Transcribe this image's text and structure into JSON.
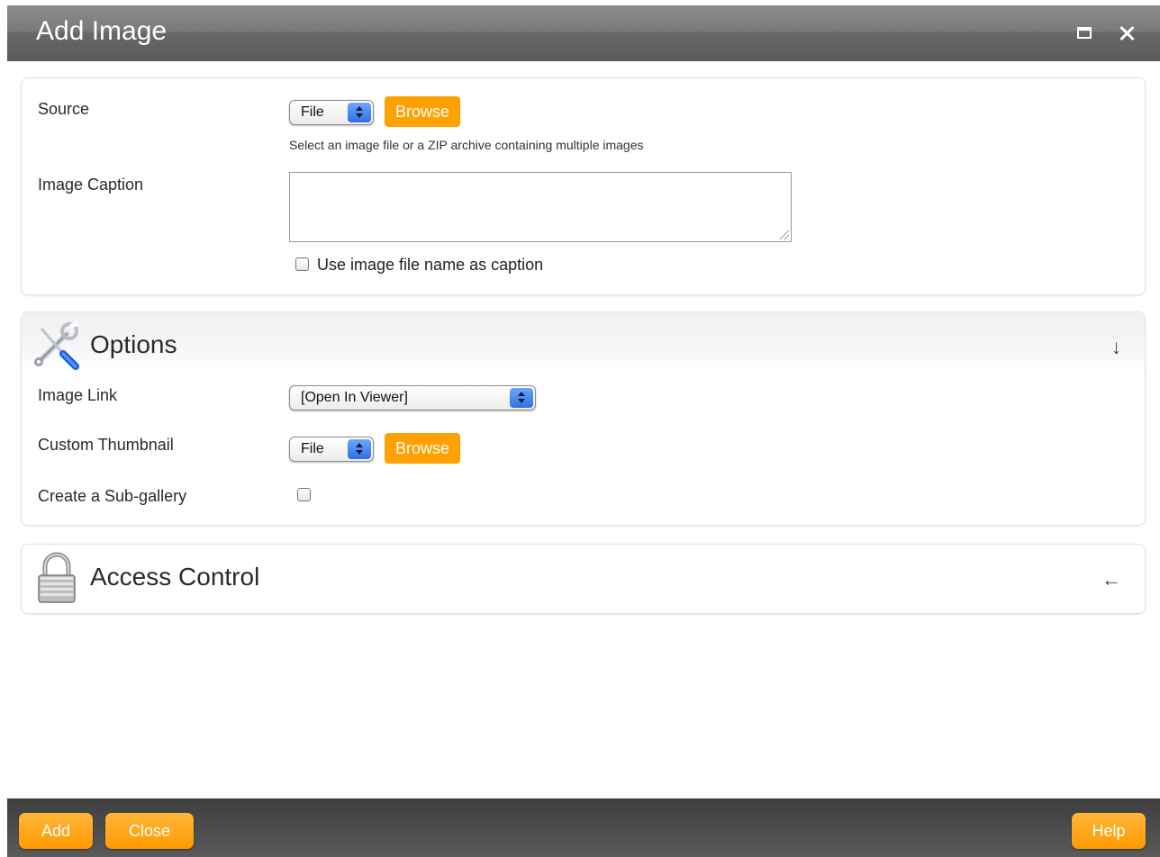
{
  "window": {
    "title": "Add Image",
    "maximize_icon": "maximize-icon",
    "close_icon": "close-icon"
  },
  "source_panel": {
    "source_label": "Source",
    "source_select_value": "File",
    "browse_label": "Browse",
    "hint": "Select an image file or a ZIP archive containing multiple images",
    "caption_label": "Image Caption",
    "caption_value": "",
    "use_filename_label": "Use image file name as caption",
    "use_filename_checked": false
  },
  "options_panel": {
    "title": "Options",
    "icon": "tools-icon",
    "toggle": "↓",
    "image_link_label": "Image Link",
    "image_link_value": "[Open In Viewer]",
    "thumbnail_label": "Custom Thumbnail",
    "thumbnail_select_value": "File",
    "thumbnail_browse_label": "Browse",
    "subgallery_label": "Create a Sub-gallery",
    "subgallery_checked": false
  },
  "access_panel": {
    "title": "Access Control",
    "icon": "lock-icon",
    "toggle": "←"
  },
  "footer": {
    "add_label": "Add",
    "close_label": "Close",
    "help_label": "Help"
  },
  "colors": {
    "accent": "#ffa100",
    "titlebar": "#6e6e6e",
    "footer": "#4a4a4a"
  }
}
